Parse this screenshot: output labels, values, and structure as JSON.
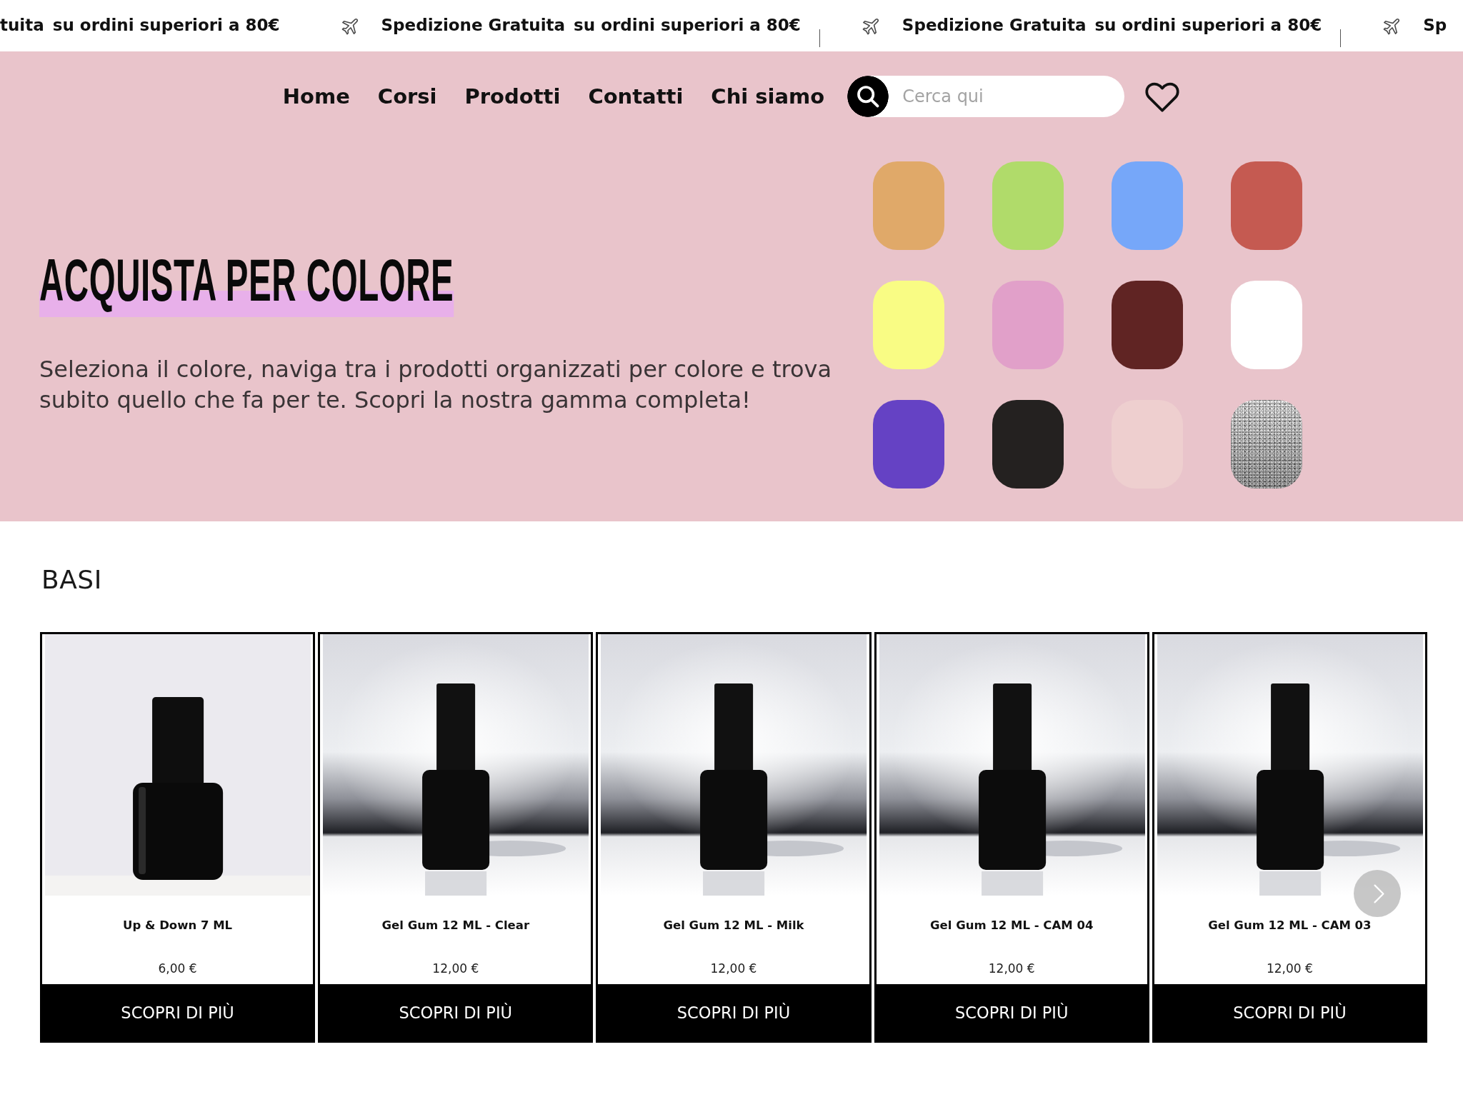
{
  "announcement_bar": {
    "items": [
      {
        "show_icon": false,
        "headline": "tuita",
        "text": "su ordini superiori a 80€",
        "divider": false
      },
      {
        "show_icon": true,
        "headline": "Spedizione Gratuita",
        "text": "su ordini superiori a 80€",
        "divider": true
      },
      {
        "show_icon": true,
        "headline": "Spedizione Gratuita",
        "text": "su ordini superiori a 80€",
        "divider": true
      },
      {
        "show_icon": true,
        "headline": "Sp",
        "divider": false
      }
    ]
  },
  "nav": {
    "links": [
      "Home",
      "Corsi",
      "Prodotti",
      "Contatti",
      "Chi siamo"
    ],
    "search": {
      "placeholder": "Cerca qui"
    }
  },
  "hero": {
    "title": "ACQUISTA PER COLORE",
    "text": "Seleziona il colore, naviga tra i prodotti organizzati per colore e trova subito quello che fa per te. Scopri la nostra gamma completa!",
    "swatches": [
      {
        "kind": "solid",
        "color": "#e0a969"
      },
      {
        "kind": "solid",
        "color": "#b0db6a"
      },
      {
        "kind": "solid",
        "color": "#76a7f9"
      },
      {
        "kind": "solid",
        "color": "#c55a51"
      },
      {
        "kind": "solid",
        "color": "#f9fc84"
      },
      {
        "kind": "solid",
        "color": "#e1a0c9"
      },
      {
        "kind": "solid",
        "color": "#602423"
      },
      {
        "kind": "solid",
        "color": "#ffffff"
      },
      {
        "kind": "solid",
        "color": "#6542c4"
      },
      {
        "kind": "solid",
        "color": "#242120"
      },
      {
        "kind": "solid",
        "color": "#eecfcf"
      },
      {
        "kind": "glitter"
      }
    ]
  },
  "products_section": {
    "title": "BASI",
    "products": [
      {
        "kind": "light",
        "title": "Up & Down 7 ML",
        "price": "6,00 €",
        "button": "SCOPRI DI PIÙ"
      },
      {
        "kind": "studio",
        "title": "Gel Gum 12 ML - Clear",
        "price": "12,00 €",
        "button": "SCOPRI DI PIÙ"
      },
      {
        "kind": "studio",
        "title": "Gel Gum 12 ML - Milk",
        "price": "12,00 €",
        "button": "SCOPRI DI PIÙ"
      },
      {
        "kind": "studio",
        "title": "Gel Gum 12 ML - CAM 04",
        "price": "12,00 €",
        "button": "SCOPRI DI PIÙ"
      },
      {
        "kind": "studio",
        "title": "Gel Gum 12 ML - CAM 03",
        "price": "12,00 €",
        "button": "SCOPRI DI PIÙ"
      }
    ]
  }
}
